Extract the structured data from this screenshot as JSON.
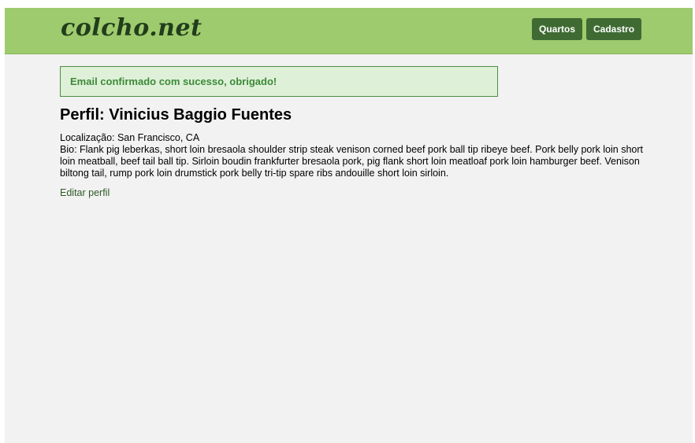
{
  "header": {
    "brand": "colcho.net",
    "nav": [
      {
        "label": "Quartos"
      },
      {
        "label": "Cadastro"
      }
    ]
  },
  "flash": {
    "message": "Email confirmado com sucesso, obrigado!"
  },
  "profile": {
    "title": "Perfil: Vinicius Baggio Fuentes",
    "location": "Localização: San Francisco, CA",
    "bio": "Bio: Flank pig leberkas, short loin bresaola shoulder strip steak venison corned beef pork ball tip ribeye beef. Pork belly pork loin short loin meatball, beef tail ball tip. Sirloin boudin frankfurter bresaola pork, pig flank short loin meatloaf pork loin hamburger beef. Venison biltong tail, rump pork loin drumstick pork belly tri-tip spare ribs andouille short loin sirloin.",
    "edit_link": "Editar perfil"
  },
  "colors": {
    "navbar": "#9ecb6d",
    "button": "#3f6b33",
    "flash_bg": "#dff0d8",
    "flash_text": "#3c8a38"
  }
}
